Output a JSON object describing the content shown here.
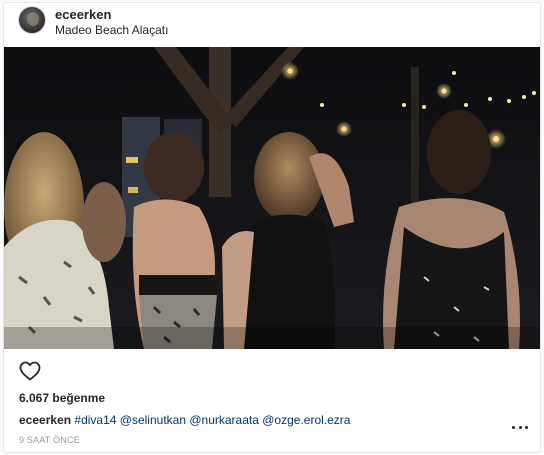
{
  "post": {
    "username": "eceerken",
    "location": "Madeo Beach Alaçatı",
    "likes_text": "6.067 beğenme",
    "caption": {
      "author": "eceerken",
      "hashtag": "#diva14",
      "mentions": [
        "@selinutkan",
        "@nurkaraata",
        "@ozge.erol.ezra"
      ]
    },
    "timestamp": "9 SAAT ÖNCE"
  },
  "icons": {
    "like": "heart-icon",
    "options": "more-options-icon",
    "avatar": "avatar"
  },
  "colors": {
    "text": "#262626",
    "link": "#003569",
    "muted": "#999999",
    "border": "#e6e6e6"
  }
}
